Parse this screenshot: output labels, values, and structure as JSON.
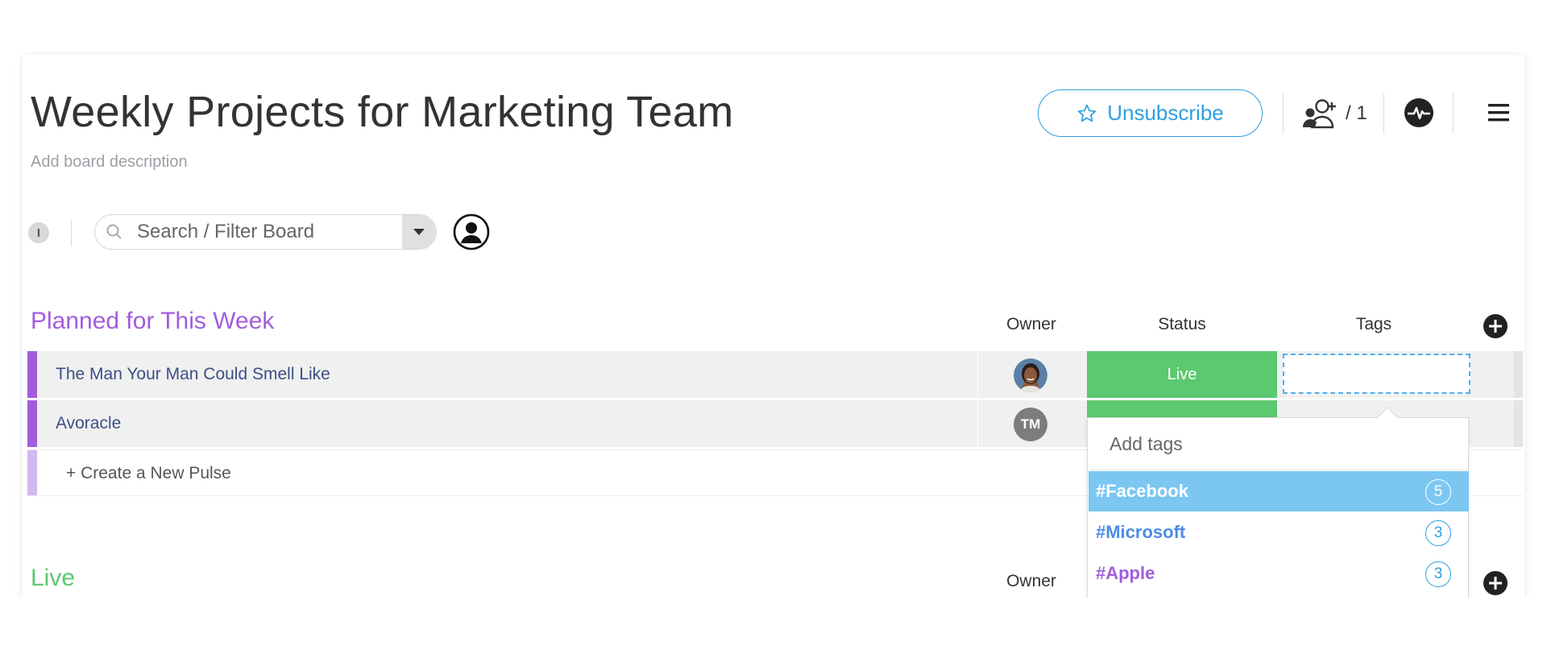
{
  "board": {
    "title": "Weekly Projects for Marketing Team",
    "description_placeholder": "Add board description"
  },
  "header": {
    "unsubscribe_label": "Unsubscribe",
    "members_count": "/ 1"
  },
  "toolbar": {
    "filter_badge": "I",
    "search_placeholder": "Search / Filter Board"
  },
  "groups": [
    {
      "title": "Planned for This Week",
      "color": "#a25ddc",
      "columns": {
        "owner": "Owner",
        "status": "Status",
        "tags": "Tags"
      },
      "rows": [
        {
          "name": "The Man Your Man Could Smell Like",
          "owner_initials": "",
          "status": "Live"
        },
        {
          "name": "Avoracle",
          "owner_initials": "TM",
          "status": ""
        }
      ],
      "create_label": "+ Create a New Pulse"
    },
    {
      "title": "Live",
      "color": "#5cc86f",
      "columns": {
        "owner": "Owner"
      }
    }
  ],
  "tags_popup": {
    "placeholder": "Add tags",
    "items": [
      {
        "label": "#Facebook",
        "count": "5",
        "color": "#ffffff"
      },
      {
        "label": "#Microsoft",
        "count": "3",
        "color": "#4c8ce6"
      },
      {
        "label": "#Apple",
        "count": "3",
        "color": "#a25ddc"
      }
    ]
  },
  "colors": {
    "accent": "#2d9fe0",
    "status_live": "#5cc86f",
    "group_purple": "#a25ddc",
    "group_green": "#5cc86f"
  }
}
